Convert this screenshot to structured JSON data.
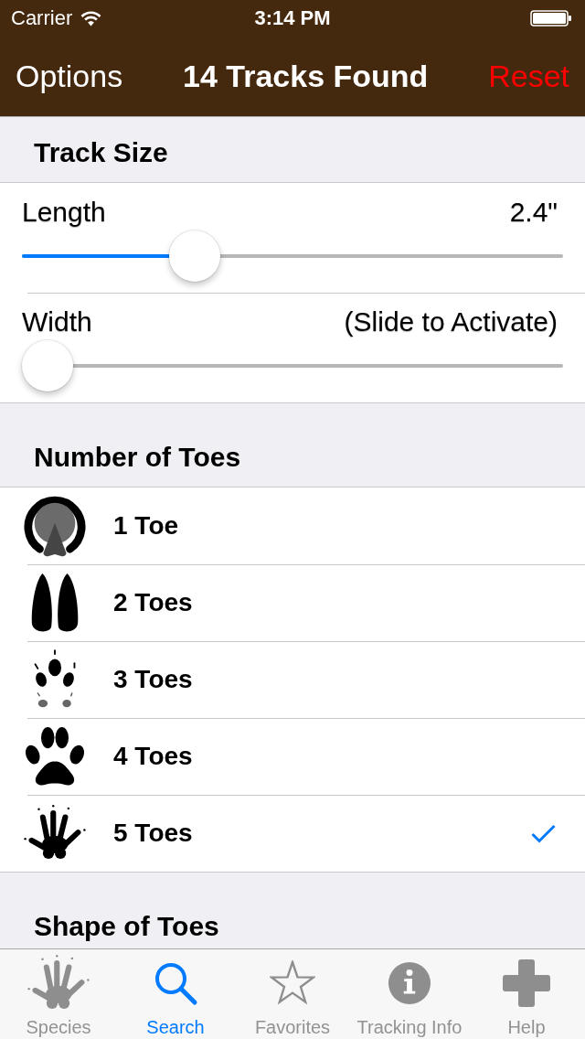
{
  "status_bar": {
    "carrier": "Carrier",
    "time": "3:14 PM"
  },
  "nav_bar": {
    "left_button": "Options",
    "title": "14 Tracks Found",
    "right_button": "Reset"
  },
  "sections": [
    {
      "header": "Track Size",
      "kind": "sliders",
      "sliders": [
        {
          "label": "Length",
          "reading": "2.4\"",
          "level": 0.3
        },
        {
          "label": "Width",
          "reading": "(Slide to Activate)",
          "level": 0
        }
      ]
    },
    {
      "header": "Number of Toes",
      "kind": "options",
      "options": [
        {
          "label": "1 Toe",
          "selected": false
        },
        {
          "label": "2 Toes",
          "selected": false
        },
        {
          "label": "3 Toes",
          "selected": false
        },
        {
          "label": "4 Toes",
          "selected": false
        },
        {
          "label": "5 Toes",
          "selected": true
        }
      ]
    },
    {
      "header": "Shape of Toes",
      "kind": "options"
    }
  ],
  "tab_bar": [
    {
      "label": "Species",
      "selected": false
    },
    {
      "label": "Search",
      "selected": true
    },
    {
      "label": "Favorites",
      "selected": false
    },
    {
      "label": "Tracking Info",
      "selected": false
    },
    {
      "label": "Help",
      "selected": false
    }
  ]
}
